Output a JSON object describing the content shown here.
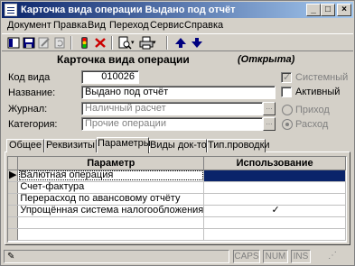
{
  "window": {
    "title": "Карточка вида операции  Выдано под отчёт"
  },
  "menu": [
    "Документ",
    "Правка",
    "Вид",
    "Переход",
    "Сервис",
    "Справка"
  ],
  "toolbar": {
    "icons": [
      "sidebar-icon",
      "save-icon",
      "edit-icon",
      "refresh-icon",
      "traffic-light-icon",
      "delete-icon",
      "print-preview-icon",
      "print-icon",
      "up-arrow-icon",
      "down-arrow-icon"
    ]
  },
  "form": {
    "title": "Карточка вида операции",
    "status": "(Открыта)",
    "code_label": "Код вида",
    "code_value": "010026",
    "name_label": "Название:",
    "name_value": "Выдано под отчёт",
    "journal_label": "Журнал:",
    "journal_value": "Наличный расчет",
    "category_label": "Категория:",
    "category_value": "Прочие операции",
    "system_label": "Системный",
    "active_label": "Активный",
    "income_label": "Приход",
    "expense_label": "Расход",
    "ellipsis": "..."
  },
  "tabs": [
    "Общее",
    "Реквизиты",
    "Параметры",
    "Виды док-тов",
    "Тип.проводки"
  ],
  "active_tab": 2,
  "grid": {
    "columns": [
      "Параметр",
      "Использование"
    ],
    "rows": [
      {
        "param": "Валютная операция",
        "use": ""
      },
      {
        "param": "Счет-фактура",
        "use": ""
      },
      {
        "param": "Перерасход по авансовому отчёту",
        "use": ""
      },
      {
        "param": "Упрощённая система налогообложения",
        "use": "✓"
      },
      {
        "param": "",
        "use": ""
      },
      {
        "param": "",
        "use": ""
      }
    ]
  },
  "statusbar": {
    "panels": [
      "CAPS",
      "NUM",
      "INS"
    ]
  },
  "colors": {
    "title_start": "#0a246a",
    "title_end": "#a6caf0",
    "selection": "#0a246a",
    "face": "#d4d0c8"
  }
}
